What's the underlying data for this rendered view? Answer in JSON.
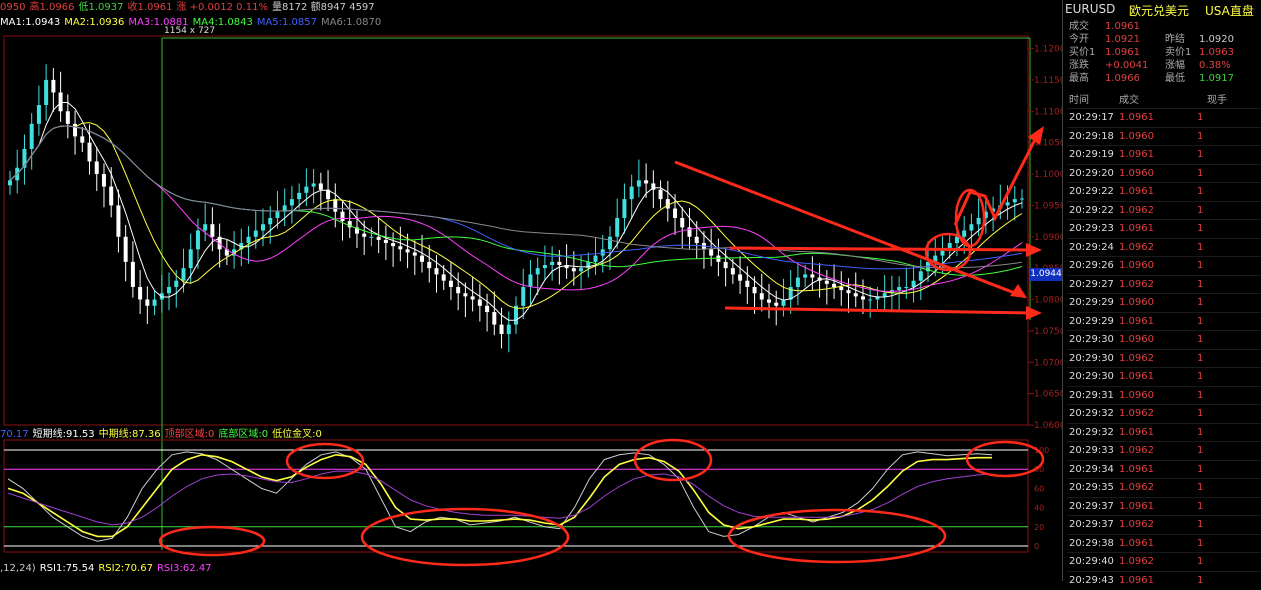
{
  "header": {
    "segments": [
      {
        "text": "0950",
        "color": "#e04040"
      },
      {
        "text": "高1.0966",
        "color": "#e04040"
      },
      {
        "text": "低1.0937",
        "color": "#40d040"
      },
      {
        "text": "收1.0961",
        "color": "#e04040"
      },
      {
        "text": "涨 +0.0012 0.11%",
        "color": "#e04040"
      },
      {
        "text": "量8172 额8947 4597",
        "color": "#cccccc"
      }
    ]
  },
  "ma_legend": [
    {
      "text": "MA1:1.0943",
      "color": "#ffffff"
    },
    {
      "text": "MA2:1.0936",
      "color": "#ffff40"
    },
    {
      "text": "MA3:1.0881",
      "color": "#ff40ff"
    },
    {
      "text": "MA4:1.0843",
      "color": "#40ff40"
    },
    {
      "text": "MA5:1.0857",
      "color": "#4060ff"
    },
    {
      "text": "MA6:1.0870",
      "color": "#888888"
    }
  ],
  "size_label": "1154 x 727",
  "indicator_legend": [
    {
      "text": "70.17",
      "color": "#4060ff"
    },
    {
      "text": "短期线:91.53",
      "color": "#ffffff"
    },
    {
      "text": "中期线:87.36",
      "color": "#ffff40"
    },
    {
      "text": "顶部区域:0",
      "color": "#ff4040"
    },
    {
      "text": "底部区域:0",
      "color": "#40ff40"
    },
    {
      "text": "低位金叉:0",
      "color": "#ffff40"
    }
  ],
  "rsi_legend": [
    {
      "text": ",12,24)",
      "color": "#cccccc"
    },
    {
      "text": "RSI1:75.54",
      "color": "#ffffff"
    },
    {
      "text": "RSI2:70.67",
      "color": "#ffff40"
    },
    {
      "text": "RSI3:62.47",
      "color": "#ff40ff"
    }
  ],
  "right_panel": {
    "symbol": "EURUSD",
    "name": "欧元兑美元",
    "market": "USA直盘",
    "quote_rows": [
      {
        "l1": "成交",
        "v1": "1.0961",
        "c1": "#e04040",
        "l2": "",
        "v2": "",
        "c2": "#e04040"
      },
      {
        "l1": "今开",
        "v1": "1.0921",
        "c1": "#e04040",
        "l2": "昨结",
        "v2": "1.0920",
        "c2": "#cccccc"
      },
      {
        "l1": "买价1",
        "v1": "1.0961",
        "c1": "#e04040",
        "l2": "卖价1",
        "v2": "1.0963",
        "c2": "#e04040"
      },
      {
        "l1": "涨跌",
        "v1": "+0.0041",
        "c1": "#e04040",
        "l2": "涨幅",
        "v2": "0.38%",
        "c2": "#e04040"
      },
      {
        "l1": "最高",
        "v1": "1.0966",
        "c1": "#e04040",
        "l2": "最低",
        "v2": "1.0917",
        "c2": "#40d040"
      }
    ],
    "table_headers": [
      "时间",
      "成交",
      "现手"
    ],
    "trades": [
      {
        "time": "20:29:17",
        "price": "1.0961",
        "vol": "1"
      },
      {
        "time": "20:29:18",
        "price": "1.0960",
        "vol": "1"
      },
      {
        "time": "20:29:19",
        "price": "1.0961",
        "vol": "1"
      },
      {
        "time": "20:29:20",
        "price": "1.0960",
        "vol": "1"
      },
      {
        "time": "20:29:22",
        "price": "1.0961",
        "vol": "1"
      },
      {
        "time": "20:29:22",
        "price": "1.0962",
        "vol": "1"
      },
      {
        "time": "20:29:23",
        "price": "1.0961",
        "vol": "1"
      },
      {
        "time": "20:29:24",
        "price": "1.0962",
        "vol": "1"
      },
      {
        "time": "20:29:26",
        "price": "1.0960",
        "vol": "1"
      },
      {
        "time": "20:29:27",
        "price": "1.0962",
        "vol": "1"
      },
      {
        "time": "20:29:29",
        "price": "1.0960",
        "vol": "1"
      },
      {
        "time": "20:29:29",
        "price": "1.0961",
        "vol": "1"
      },
      {
        "time": "20:29:30",
        "price": "1.0960",
        "vol": "1"
      },
      {
        "time": "20:29:30",
        "price": "1.0962",
        "vol": "1"
      },
      {
        "time": "20:29:30",
        "price": "1.0961",
        "vol": "1"
      },
      {
        "time": "20:29:31",
        "price": "1.0960",
        "vol": "1"
      },
      {
        "time": "20:29:32",
        "price": "1.0962",
        "vol": "1"
      },
      {
        "time": "20:29:32",
        "price": "1.0961",
        "vol": "1"
      },
      {
        "time": "20:29:33",
        "price": "1.0962",
        "vol": "1"
      },
      {
        "time": "20:29:34",
        "price": "1.0961",
        "vol": "1"
      },
      {
        "time": "20:29:35",
        "price": "1.0962",
        "vol": "1"
      },
      {
        "time": "20:29:37",
        "price": "1.0961",
        "vol": "1"
      },
      {
        "time": "20:29:37",
        "price": "1.0962",
        "vol": "1"
      },
      {
        "time": "20:29:38",
        "price": "1.0961",
        "vol": "1"
      },
      {
        "time": "20:29:40",
        "price": "1.0962",
        "vol": "1"
      },
      {
        "time": "20:29:43",
        "price": "1.0961",
        "vol": "1"
      }
    ],
    "current_price_tag": "1.0944"
  },
  "chart_data": [
    {
      "type": "line",
      "title": "",
      "price_axis_ticks": [
        "1.1200",
        "1.1150",
        "1.1100",
        "1.1050",
        "1.1000",
        "1.0950",
        "1.0900",
        "1.0850",
        "1.0800",
        "1.0750",
        "1.0700",
        "1.0650",
        "1.0600"
      ],
      "ylim": [
        1.06,
        1.122
      ],
      "x_count": 200,
      "close": [
        1.099,
        1.101,
        1.104,
        1.108,
        1.111,
        1.115,
        1.113,
        1.11,
        1.108,
        1.106,
        1.105,
        1.102,
        1.1,
        1.098,
        1.095,
        1.09,
        1.086,
        1.082,
        1.08,
        1.079,
        1.08,
        1.081,
        1.082,
        1.083,
        1.085,
        1.088,
        1.091,
        1.092,
        1.09,
        1.088,
        1.087,
        1.088,
        1.089,
        1.09,
        1.091,
        1.092,
        1.093,
        1.094,
        1.095,
        1.096,
        1.097,
        1.098,
        1.0985,
        1.0975,
        1.096,
        1.094,
        1.0925,
        1.0915,
        1.0905,
        1.09,
        1.09,
        1.0895,
        1.089,
        1.0885,
        1.088,
        1.0875,
        1.087,
        1.086,
        1.085,
        1.084,
        1.083,
        1.082,
        1.081,
        1.0805,
        1.08,
        1.079,
        1.078,
        1.076,
        1.0745,
        1.076,
        1.079,
        1.082,
        1.084,
        1.085,
        1.0855,
        1.086,
        1.0855,
        1.085,
        1.0845,
        1.085,
        1.086,
        1.087,
        1.088,
        1.09,
        1.093,
        1.096,
        1.098,
        1.099,
        1.0985,
        1.0975,
        1.096,
        1.0945,
        1.093,
        1.0915,
        1.09,
        1.089,
        1.088,
        1.087,
        1.086,
        1.085,
        1.084,
        1.083,
        1.082,
        1.081,
        1.08,
        1.0795,
        1.079,
        1.08,
        1.082,
        1.0835,
        1.084,
        1.0835,
        1.083,
        1.0825,
        1.082,
        1.0815,
        1.081,
        1.0805,
        1.08,
        1.08,
        1.0805,
        1.081,
        1.0815,
        1.082,
        1.082,
        1.083,
        1.0845,
        1.086,
        1.087,
        1.088,
        1.089,
        1.09,
        1.091,
        1.092,
        1.093,
        1.094,
        1.0945,
        1.095,
        1.0955,
        1.096,
        1.0961
      ],
      "ma_series": [
        {
          "name": "MA1",
          "color": "#ffffff"
        },
        {
          "name": "MA2",
          "color": "#ffff40"
        },
        {
          "name": "MA3",
          "color": "#ff40ff"
        },
        {
          "name": "MA4",
          "color": "#40ff40"
        },
        {
          "name": "MA5",
          "color": "#4060ff"
        },
        {
          "name": "MA6",
          "color": "#888888"
        }
      ]
    },
    {
      "type": "line",
      "title": "",
      "ylim": [
        0,
        100
      ],
      "reference_levels": [
        100,
        80,
        20,
        0
      ],
      "series": [
        {
          "name": "短期线",
          "color": "#cccccc",
          "values": [
            70,
            60,
            45,
            30,
            20,
            10,
            5,
            8,
            30,
            60,
            80,
            95,
            98,
            96,
            90,
            80,
            70,
            60,
            55,
            70,
            85,
            95,
            98,
            92,
            80,
            50,
            20,
            15,
            25,
            30,
            28,
            22,
            24,
            26,
            30,
            25,
            20,
            18,
            40,
            70,
            90,
            95,
            97,
            95,
            85,
            70,
            40,
            15,
            10,
            12,
            20,
            30,
            35,
            30,
            25,
            30,
            35,
            45,
            60,
            80,
            95,
            98,
            96,
            94,
            95,
            96,
            95
          ]
        },
        {
          "name": "中期线",
          "color": "#ffff40",
          "values": [
            60,
            55,
            45,
            35,
            25,
            15,
            10,
            10,
            20,
            40,
            60,
            80,
            90,
            95,
            93,
            88,
            80,
            72,
            68,
            72,
            82,
            90,
            95,
            93,
            85,
            65,
            40,
            28,
            27,
            28,
            28,
            26,
            26,
            27,
            28,
            27,
            24,
            22,
            30,
            50,
            72,
            85,
            90,
            92,
            88,
            78,
            58,
            35,
            22,
            18,
            20,
            24,
            28,
            28,
            27,
            28,
            31,
            38,
            48,
            62,
            78,
            88,
            90,
            90,
            91,
            92,
            92
          ]
        },
        {
          "name": "RSI3",
          "color": "#a040d0",
          "values": [
            55,
            50,
            45,
            40,
            35,
            30,
            25,
            22,
            24,
            30,
            40,
            52,
            62,
            70,
            74,
            75,
            73,
            70,
            67,
            66,
            70,
            75,
            78,
            78,
            75,
            68,
            58,
            48,
            42,
            38,
            35,
            33,
            32,
            32,
            32,
            31,
            30,
            29,
            32,
            40,
            52,
            62,
            70,
            74,
            75,
            72,
            64,
            52,
            42,
            35,
            31,
            30,
            30,
            30,
            30,
            30,
            31,
            34,
            38,
            45,
            54,
            62,
            67,
            70,
            72,
            74,
            75
          ]
        }
      ]
    }
  ]
}
